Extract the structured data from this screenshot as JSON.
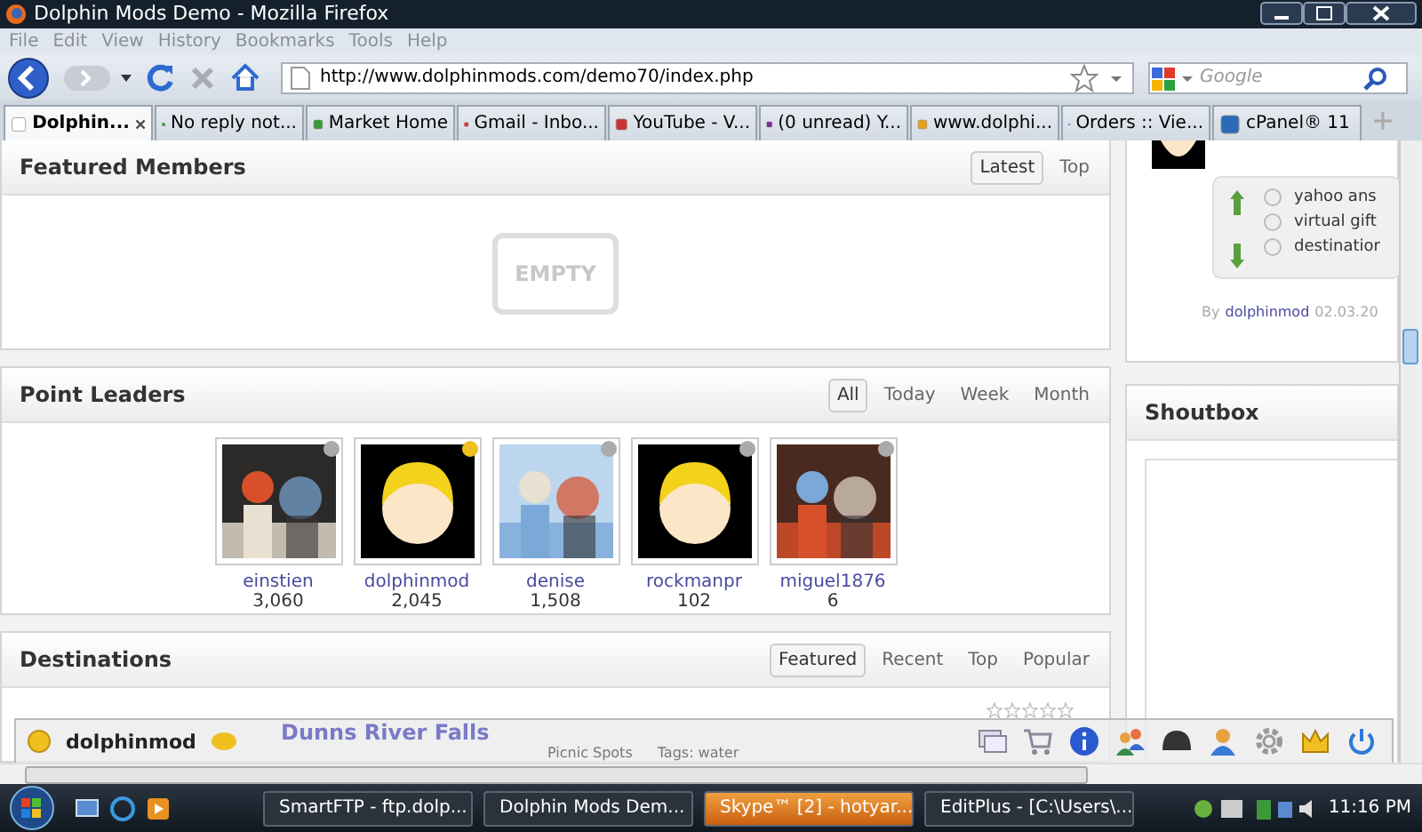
{
  "window": {
    "title": "Dolphin Mods Demo - Mozilla Firefox"
  },
  "menu": [
    "File",
    "Edit",
    "View",
    "History",
    "Bookmarks",
    "Tools",
    "Help"
  ],
  "address": {
    "value": "http://www.dolphinmods.com/demo70/index.php"
  },
  "search": {
    "placeholder": "Google"
  },
  "tabs": [
    {
      "label": "Dolphin...",
      "selected": true
    },
    {
      "label": "No reply not...",
      "selected": false
    },
    {
      "label": "Market Home",
      "selected": false
    },
    {
      "label": "Gmail - Inbo...",
      "selected": false
    },
    {
      "label": "YouTube - V...",
      "selected": false
    },
    {
      "label": "(0 unread) Y...",
      "selected": false
    },
    {
      "label": "www.dolphi...",
      "selected": false
    },
    {
      "label": "Orders :: Vie...",
      "selected": false
    },
    {
      "label": "cPanel® 11",
      "selected": false
    }
  ],
  "featured_members": {
    "title": "Featured Members",
    "tabs": [
      {
        "label": "Latest",
        "selected": true
      },
      {
        "label": "Top",
        "selected": false
      }
    ],
    "empty": "EMPTY"
  },
  "point_leaders": {
    "title": "Point Leaders",
    "tabs": [
      {
        "label": "All",
        "selected": true
      },
      {
        "label": "Today",
        "selected": false
      },
      {
        "label": "Week",
        "selected": false
      },
      {
        "label": "Month",
        "selected": false
      }
    ],
    "members": [
      {
        "name": "einstien",
        "points": "3,060",
        "online": false
      },
      {
        "name": "dolphinmod",
        "points": "2,045",
        "online": true,
        "kind": "avatar"
      },
      {
        "name": "denise",
        "points": "1,508",
        "online": false
      },
      {
        "name": "rockmanpr",
        "points": "102",
        "online": false,
        "kind": "avatar"
      },
      {
        "name": "miguel1876",
        "points": "6",
        "online": false
      }
    ]
  },
  "destinations": {
    "title": "Destinations",
    "tabs": [
      {
        "label": "Featured",
        "selected": true
      },
      {
        "label": "Recent",
        "selected": false
      },
      {
        "label": "Top",
        "selected": false
      },
      {
        "label": "Popular",
        "selected": false
      }
    ],
    "item": {
      "title": "Dunns River Falls",
      "category": "Picnic Spots",
      "tags": "Tags: water",
      "stars": 0
    }
  },
  "poll": {
    "options": [
      {
        "label": "yahoo ans",
        "selected": false
      },
      {
        "label": "virtual gift",
        "selected": false
      },
      {
        "label": "destinatior",
        "selected": false
      }
    ]
  },
  "post": {
    "by": "By",
    "author": "dolphinmod",
    "date": "02.03.20"
  },
  "shoutbox": {
    "title": "Shoutbox"
  },
  "member_bar": {
    "user": "dolphinmod"
  },
  "taskbar": {
    "items": [
      {
        "label": "SmartFTP - ftp.dolp...",
        "highlighted": false
      },
      {
        "label": "Dolphin Mods Dem...",
        "highlighted": false
      },
      {
        "label": "Skype™ [2] - hotyar...",
        "highlighted": true
      },
      {
        "label": "EditPlus - [C:\\Users\\...",
        "highlighted": false
      }
    ],
    "clock": "11:16 PM"
  }
}
